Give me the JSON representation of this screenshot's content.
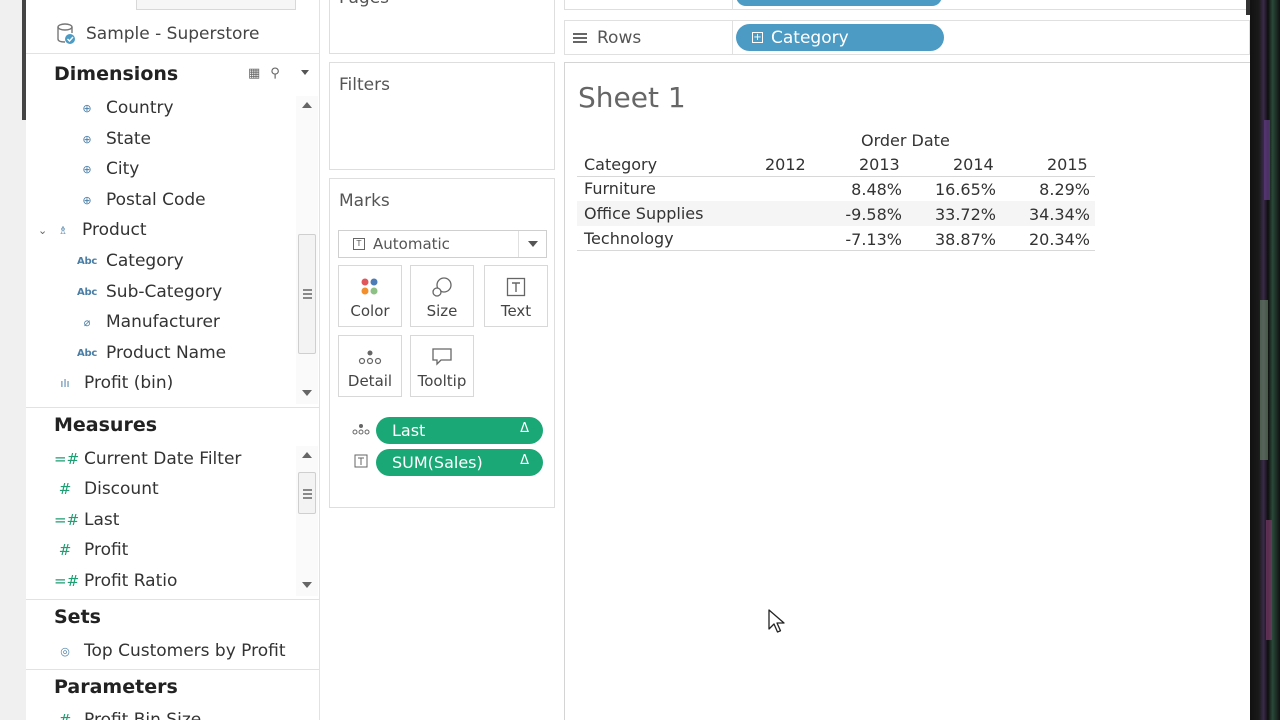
{
  "data_pane": {
    "datasource": "Sample - Superstore",
    "dimensions_title": "Dimensions",
    "dimensions": [
      {
        "label": "Country",
        "icon": "globe-icon"
      },
      {
        "label": "State",
        "icon": "globe-icon"
      },
      {
        "label": "City",
        "icon": "globe-icon"
      },
      {
        "label": "Postal Code",
        "icon": "globe-icon"
      },
      {
        "label": "Product",
        "icon": "hierarchy-icon"
      },
      {
        "label": "Category",
        "icon": "abc-icon"
      },
      {
        "label": "Sub-Category",
        "icon": "abc-icon"
      },
      {
        "label": "Manufacturer",
        "icon": "paperclip-icon"
      },
      {
        "label": "Product Name",
        "icon": "abc-icon"
      },
      {
        "label": "Profit (bin)",
        "icon": "bin-icon"
      }
    ],
    "measures_title": "Measures",
    "measures": [
      {
        "label": "Current Date Filter",
        "icon": "calc-measure-icon"
      },
      {
        "label": "Discount",
        "icon": "measure-icon"
      },
      {
        "label": "Last",
        "icon": "calc-measure-icon"
      },
      {
        "label": "Profit",
        "icon": "measure-icon"
      },
      {
        "label": "Profit Ratio",
        "icon": "calc-measure-icon"
      }
    ],
    "sets_title": "Sets",
    "sets": [
      {
        "label": "Top Customers by Profit",
        "icon": "set-icon"
      }
    ],
    "parameters_title": "Parameters",
    "parameters": [
      {
        "label": "Profit Bin Size",
        "icon": "parameter-icon"
      }
    ]
  },
  "cards": {
    "pages_title": "Pages",
    "filters_title": "Filters",
    "marks_title": "Marks",
    "mark_type": "Automatic",
    "mark_buttons": {
      "color": "Color",
      "size": "Size",
      "text": "Text",
      "detail": "Detail",
      "tooltip": "Tooltip"
    },
    "mark_pills": [
      {
        "label": "Last",
        "delta": "Δ",
        "icon": "detail-icon"
      },
      {
        "label": "SUM(Sales)",
        "delta": "Δ",
        "icon": "text-icon"
      }
    ]
  },
  "shelves": {
    "rows_label": "Rows",
    "rows_pill": "Category"
  },
  "view": {
    "sheet_title": "Sheet 1",
    "column_group": "Order Date",
    "row_header": "Category",
    "years": [
      "2012",
      "2013",
      "2014",
      "2015"
    ],
    "rows": [
      {
        "category": "Furniture",
        "values": [
          "",
          "8.48%",
          "16.65%",
          "8.29%"
        ]
      },
      {
        "category": "Office Supplies",
        "values": [
          "",
          "-9.58%",
          "33.72%",
          "34.34%"
        ]
      },
      {
        "category": "Technology",
        "values": [
          "",
          "-7.13%",
          "38.87%",
          "20.34%"
        ]
      }
    ]
  },
  "colors": {
    "green_pill": "#1aa876",
    "blue_pill": "#4c9bc5",
    "measure_icon": "#1e9e73",
    "dimension_icon": "#4a7ea6"
  }
}
